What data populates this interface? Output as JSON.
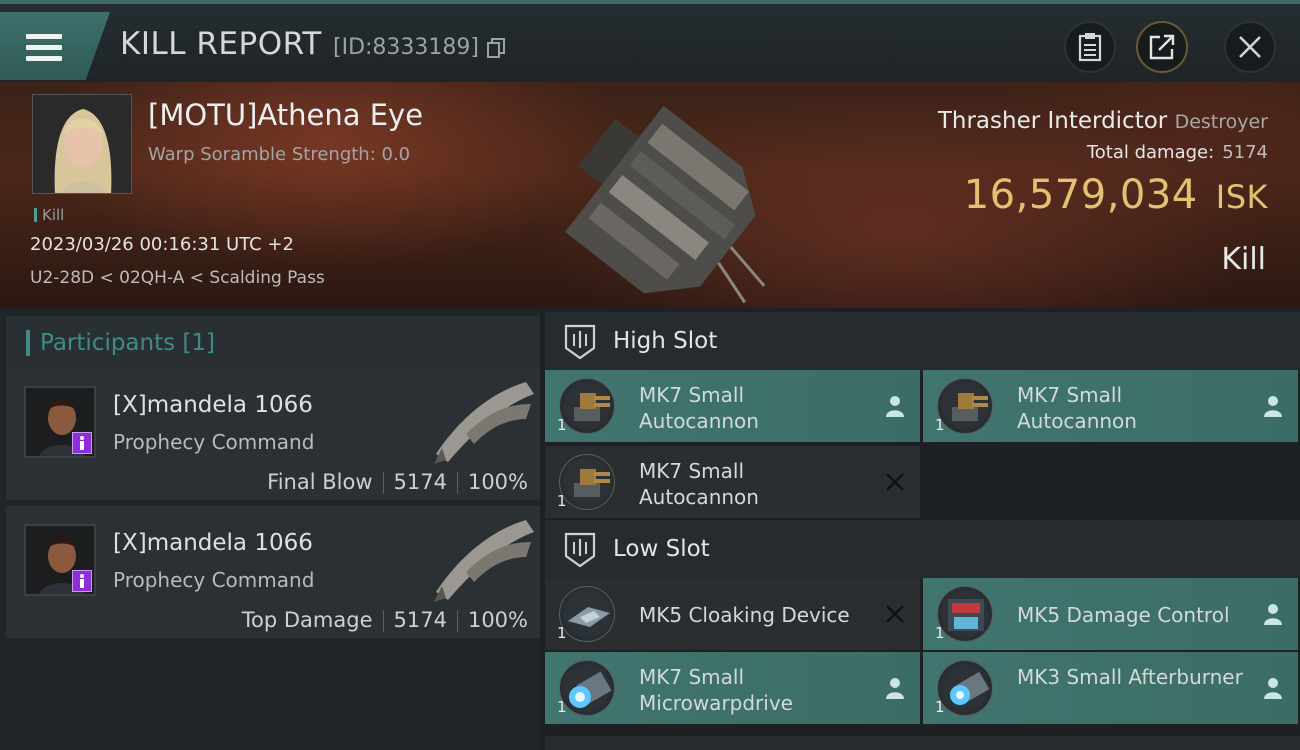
{
  "header": {
    "title": "KILL REPORT",
    "id_label": "[ID:8333189]"
  },
  "victim": {
    "name": "[MOTU]Athena Eye",
    "scramble": "Warp Soramble Strength: 0.0",
    "tag": "Kill",
    "datetime": "2023/03/26 00:16:31 UTC +2",
    "location": "U2-28D < 02QH-A < Scalding Pass",
    "ship_name": "Thrasher Interdictor",
    "ship_class": "Destroyer",
    "total_damage_label": "Total damage:",
    "total_damage": "5174",
    "isk_value": "16,579,034",
    "isk_unit": "ISK",
    "result": "Kill"
  },
  "participants": {
    "label": "Participants [1]",
    "items": [
      {
        "name": "[X]mandela 1066",
        "ship": "Prophecy Command",
        "role": "Final Blow",
        "damage": "5174",
        "percent": "100%"
      },
      {
        "name": "[X]mandela 1066",
        "ship": "Prophecy Command",
        "role": "Top Damage",
        "damage": "5174",
        "percent": "100%"
      }
    ]
  },
  "slots": {
    "high": {
      "label": "High Slot",
      "modules": [
        {
          "name": "MK7 Small Autocannon",
          "qty": "1",
          "status": "dropped",
          "icon": "autocannon-icon"
        },
        {
          "name": "MK7 Small Autocannon",
          "qty": "1",
          "status": "dropped",
          "icon": "autocannon-icon"
        },
        {
          "name": "MK7 Small Autocannon",
          "qty": "1",
          "status": "destroyed",
          "icon": "autocannon-icon"
        }
      ]
    },
    "low": {
      "label": "Low Slot",
      "modules": [
        {
          "name": "MK5 Cloaking Device",
          "qty": "1",
          "status": "destroyed",
          "icon": "cloak-icon"
        },
        {
          "name": "MK5 Damage Control",
          "qty": "1",
          "status": "dropped",
          "icon": "damage-control-icon"
        },
        {
          "name": "MK7 Small Microwarpdrive",
          "qty": "1",
          "status": "dropped",
          "icon": "microwarpdrive-icon"
        },
        {
          "name": "MK3 Small Afterburner",
          "qty": "1",
          "status": "dropped",
          "icon": "afterburner-icon"
        }
      ]
    }
  },
  "colors": {
    "accent_teal": "#3f8c86",
    "isk_gold": "#e2c173",
    "badge_purple": "#8d2fd6"
  }
}
